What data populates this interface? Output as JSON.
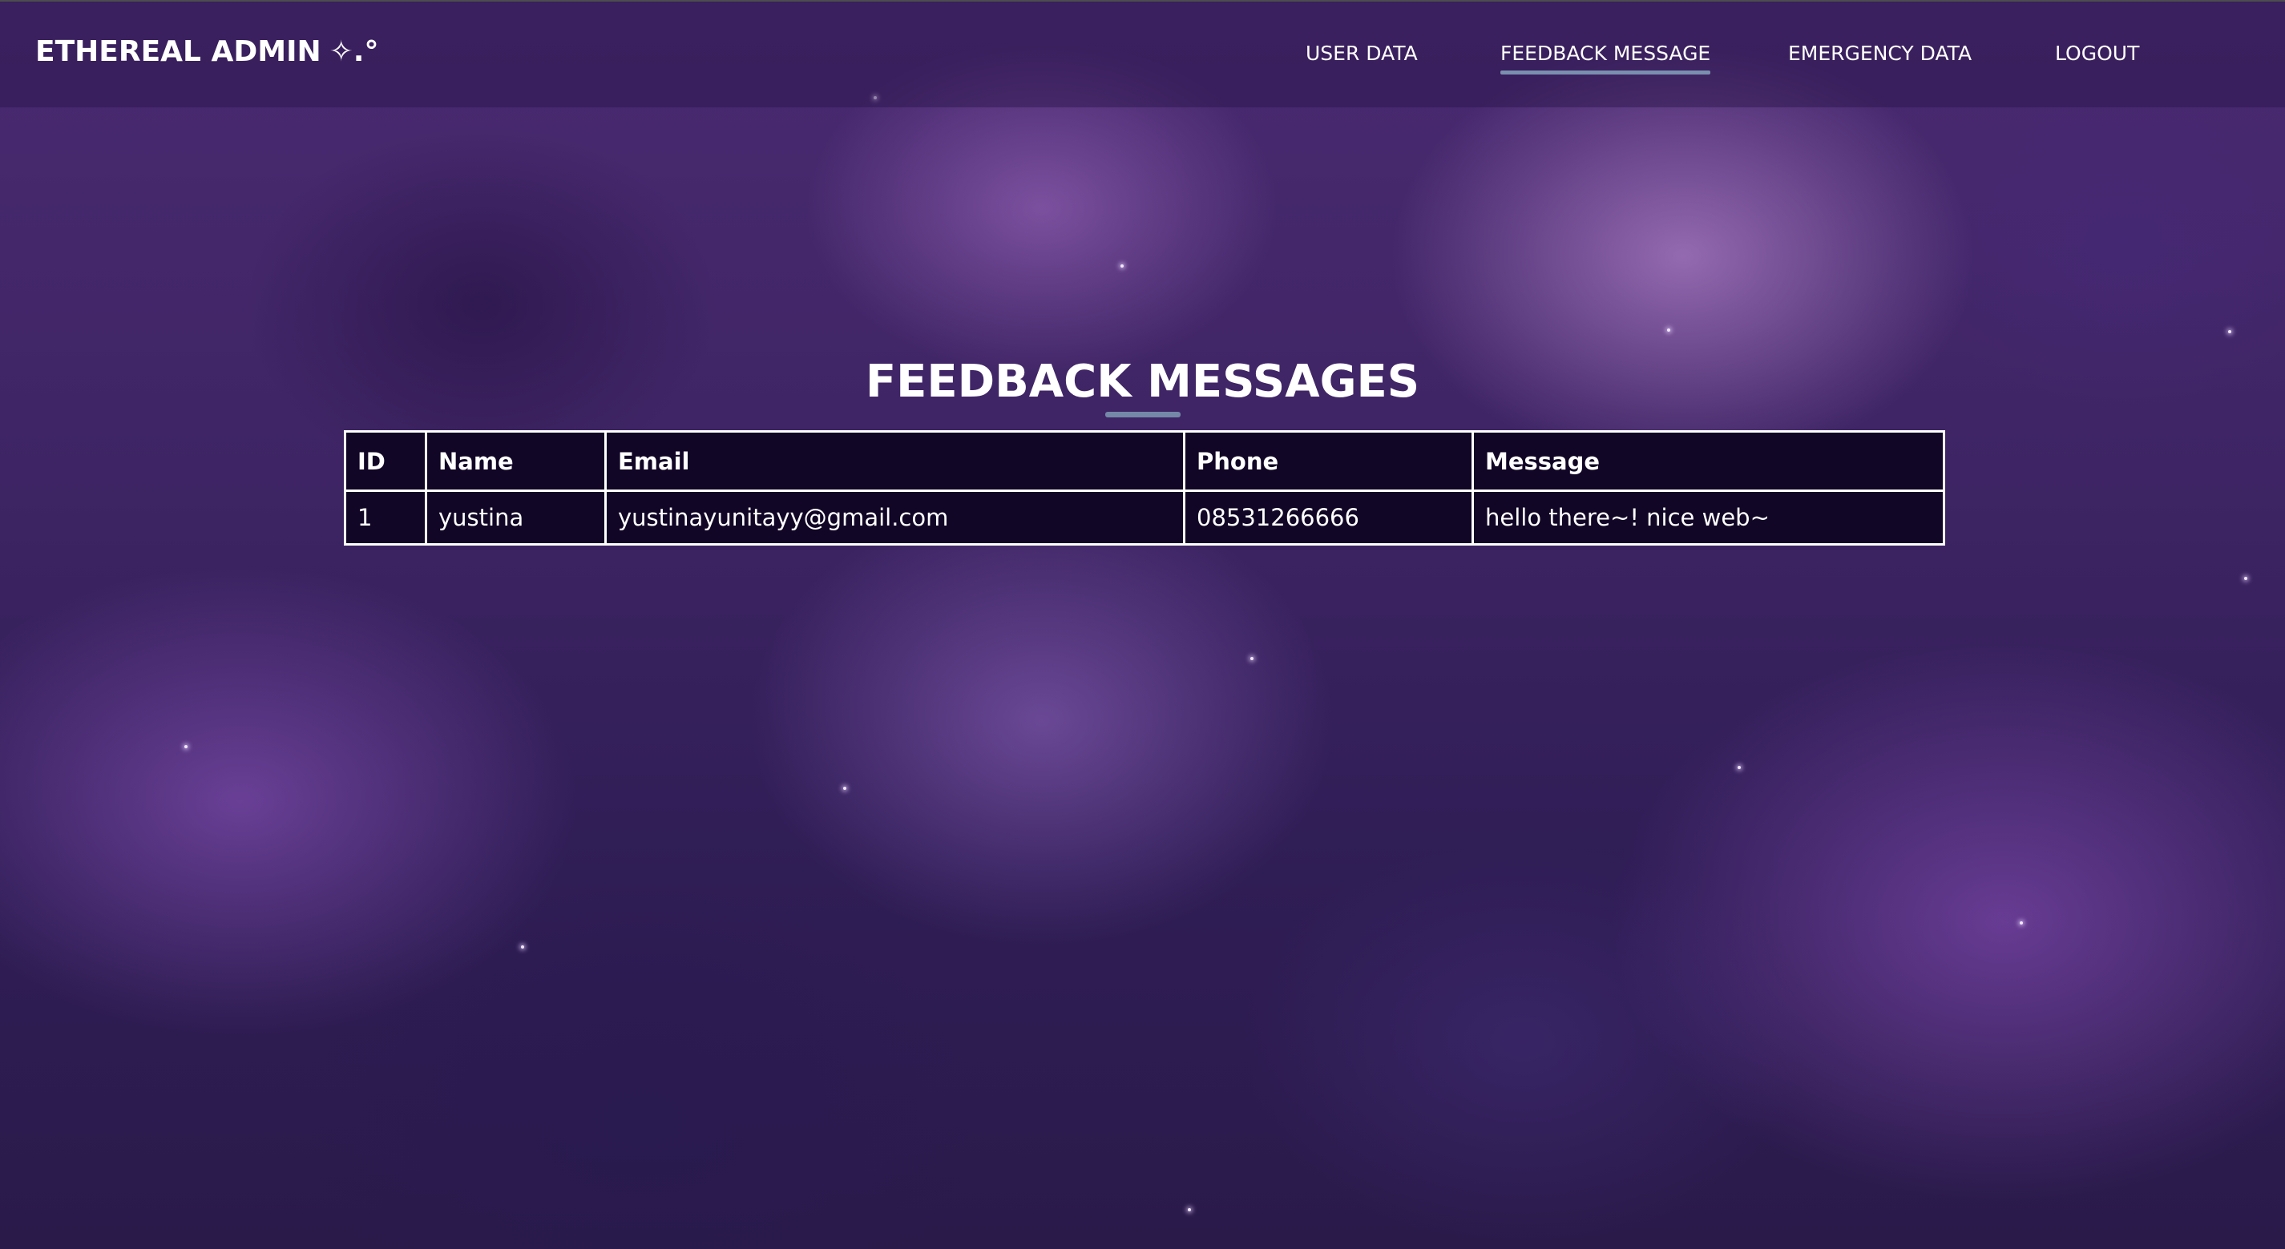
{
  "app": {
    "brand": "ETHEREAL ADMIN",
    "brand_sparkle": "✧.°"
  },
  "nav": {
    "items": [
      {
        "label": "USER DATA",
        "active": false
      },
      {
        "label": "FEEDBACK MESSAGE",
        "active": true
      },
      {
        "label": "EMERGENCY DATA",
        "active": false
      },
      {
        "label": "LOGOUT",
        "active": false
      }
    ]
  },
  "page": {
    "title": "FEEDBACK MESSAGES"
  },
  "table": {
    "headers": [
      "ID",
      "Name",
      "Email",
      "Phone",
      "Message"
    ],
    "rows": [
      [
        "1",
        "yustina",
        "yustinayunitayy@gmail.com",
        "08531266666",
        "hello there~! nice web~"
      ]
    ]
  },
  "colors": {
    "accent_underline": "#7a8fae",
    "table_background": "#110626",
    "navbar_background": "rgba(40, 20, 70, 0.45)"
  }
}
